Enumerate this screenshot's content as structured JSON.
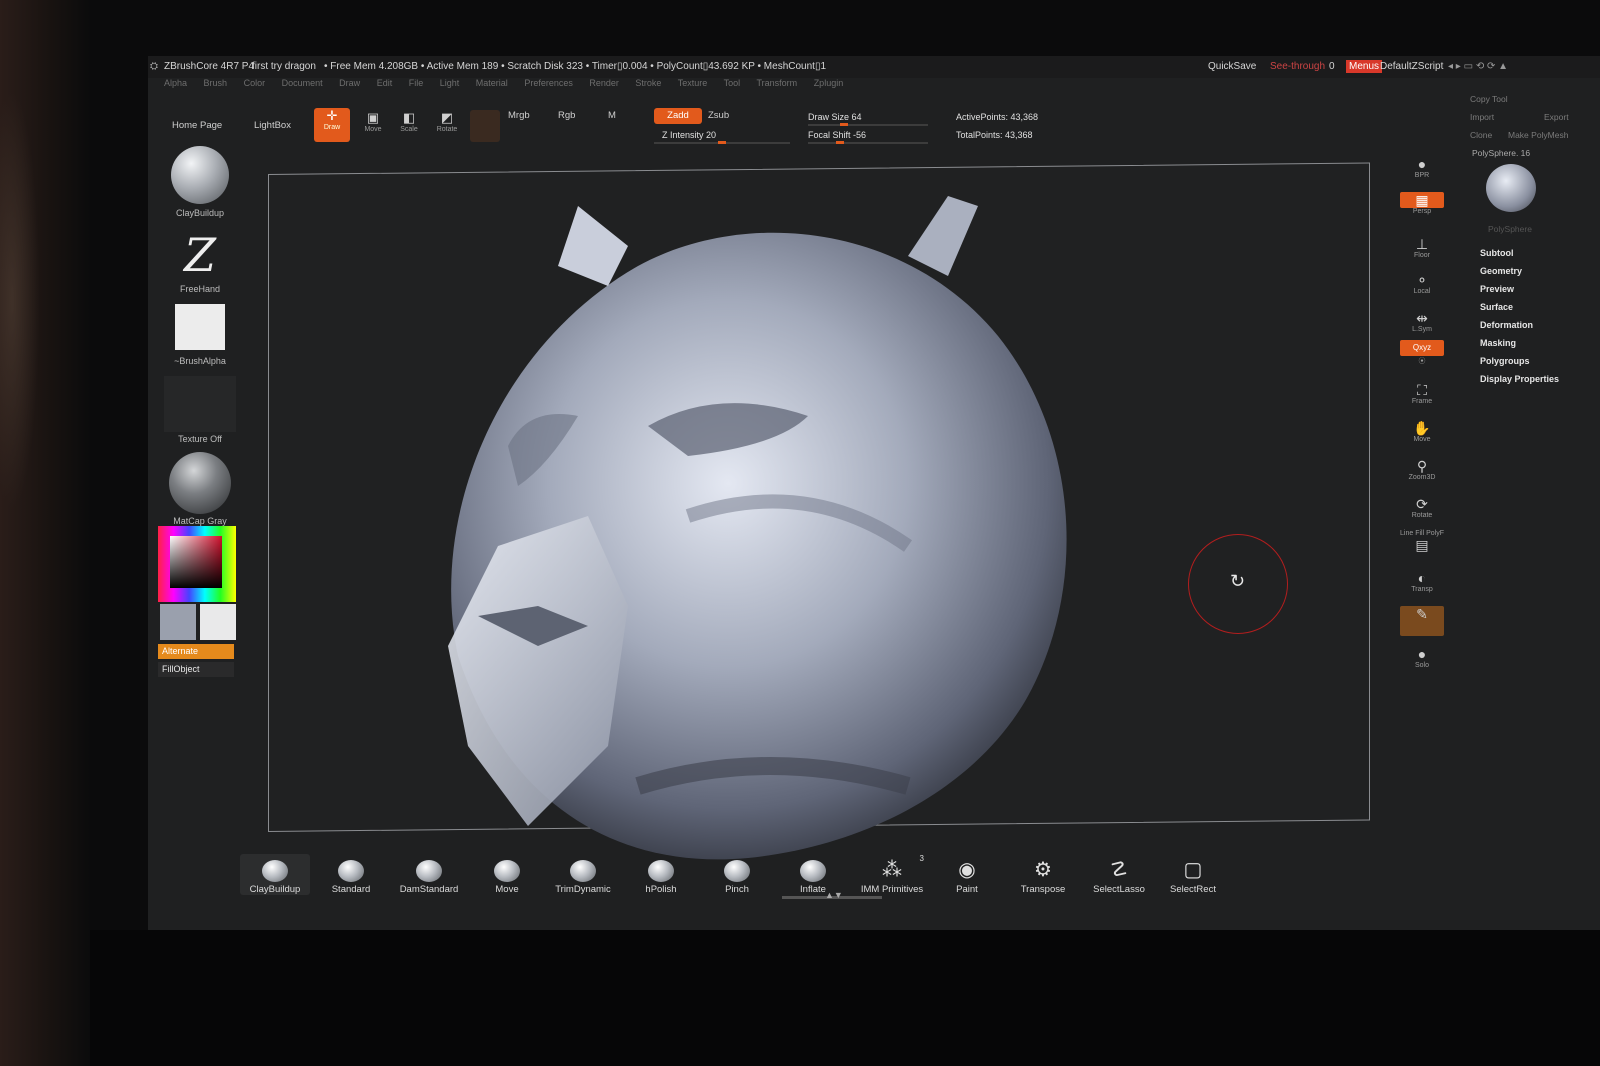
{
  "titlebar": {
    "app": "ZBrushCore 4R7 P4",
    "doc": "first try dragon",
    "stats": "• Free Mem 4.208GB • Active Mem 189 • Scratch Disk 323 • Timer▯0.004 • PolyCount▯43.692 KP • MeshCount▯1",
    "quicksave": "QuickSave",
    "seethrough": "See-through",
    "seethrough_val": "0",
    "menus_btn": "Menus",
    "script": "DefaultZScript"
  },
  "menubar": [
    "Alpha",
    "Brush",
    "Color",
    "Document",
    "Draw",
    "Edit",
    "File",
    "Light",
    "Material",
    "Preferences",
    "Render",
    "Stroke",
    "Texture",
    "Tool",
    "Transform",
    "Zplugin"
  ],
  "toolbar": {
    "home": "Home Page",
    "lightbox": "LightBox",
    "draw": "Draw",
    "move": "Move",
    "scale": "Scale",
    "rotate": "Rotate",
    "mrgb": "Mrgb",
    "rgb": "Rgb",
    "m": "M",
    "zadd": "Zadd",
    "zsub": "Zsub",
    "zintensity": "Z Intensity 20",
    "drawsize": "Draw Size 64",
    "focalshift": "Focal Shift -56",
    "activepoints": "ActivePoints: 43,368",
    "totalpoints": "TotalPoints: 43,368"
  },
  "left": {
    "brush": "ClayBuildup",
    "stroke": "FreeHand",
    "alpha": "~BrushAlpha",
    "texture": "Texture Off",
    "material": "MatCap Gray",
    "alternate": "Alternate",
    "fillobject": "FillObject"
  },
  "rightnav": [
    "BPR",
    "Persp",
    "Floor",
    "Local",
    "L.Sym",
    "Qxyz",
    "Frame",
    "Move",
    "Zoom3D",
    "Rotate",
    "Line Fill PolyF",
    "Transp",
    "Solo"
  ],
  "tray": {
    "copytool": "Copy Tool",
    "import": "Import",
    "export": "Export",
    "clone": "Clone",
    "makepolymesh": "Make PolyMesh",
    "polysphere_label": "PolySphere. 16",
    "polysphere_name": "PolySphere",
    "sections": [
      "Subtool",
      "Geometry",
      "Preview",
      "Surface",
      "Deformation",
      "Masking",
      "Polygroups",
      "Display Properties"
    ]
  },
  "brushbar": {
    "items": [
      "ClayBuildup",
      "Standard",
      "DamStandard",
      "Move",
      "TrimDynamic",
      "hPolish",
      "Pinch",
      "Inflate",
      "IMM Primitives",
      "Paint",
      "Transpose",
      "SelectLasso",
      "SelectRect"
    ],
    "imm_count": "3"
  },
  "colors": {
    "accent": "#e25a1c",
    "alt_orange": "#e58a1c",
    "cursor_ring": "#b21e1e"
  }
}
